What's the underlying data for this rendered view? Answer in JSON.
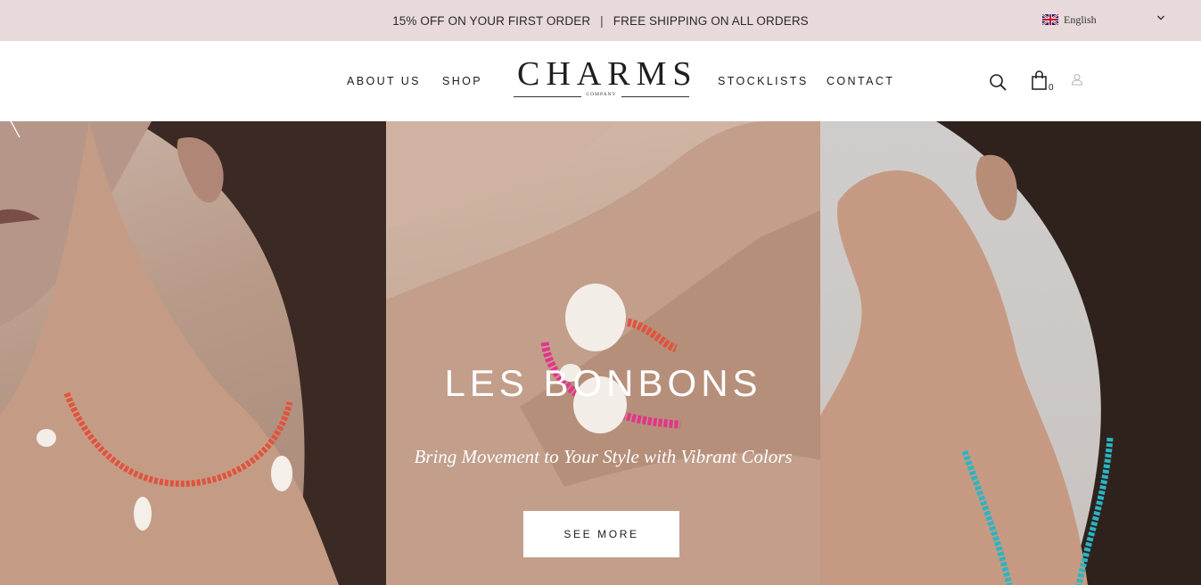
{
  "announcement": {
    "offer": "15% OFF ON YOUR FIRST ORDER",
    "separator": "|",
    "shipping": "FREE SHIPPING ON ALL ORDERS"
  },
  "language": {
    "label": "English",
    "flag_icon": "uk-flag-icon"
  },
  "nav": {
    "about": "ABOUT US",
    "shop": "SHOP",
    "stocklists": "STOCKLISTS",
    "contact": "CONTACT"
  },
  "logo": {
    "word": "CHARMS",
    "sub": "COMPANY"
  },
  "cart": {
    "count": "0"
  },
  "icons": [
    "search-icon",
    "shopping-bag-icon",
    "user-icon",
    "chevron-down-icon",
    "prev-arrow-icon"
  ],
  "hero": {
    "title": "LES BONBONS",
    "subtitle": "Bring Movement to Your Style with Vibrant Colors",
    "button": "SEE MORE"
  },
  "colors": {
    "topbar_bg": "#e8d9da",
    "text_dark": "#1c1c1c",
    "coral_beads": "#e0533c",
    "turquoise_beads": "#2ab5c4",
    "pink_beads": "#e2358a"
  }
}
